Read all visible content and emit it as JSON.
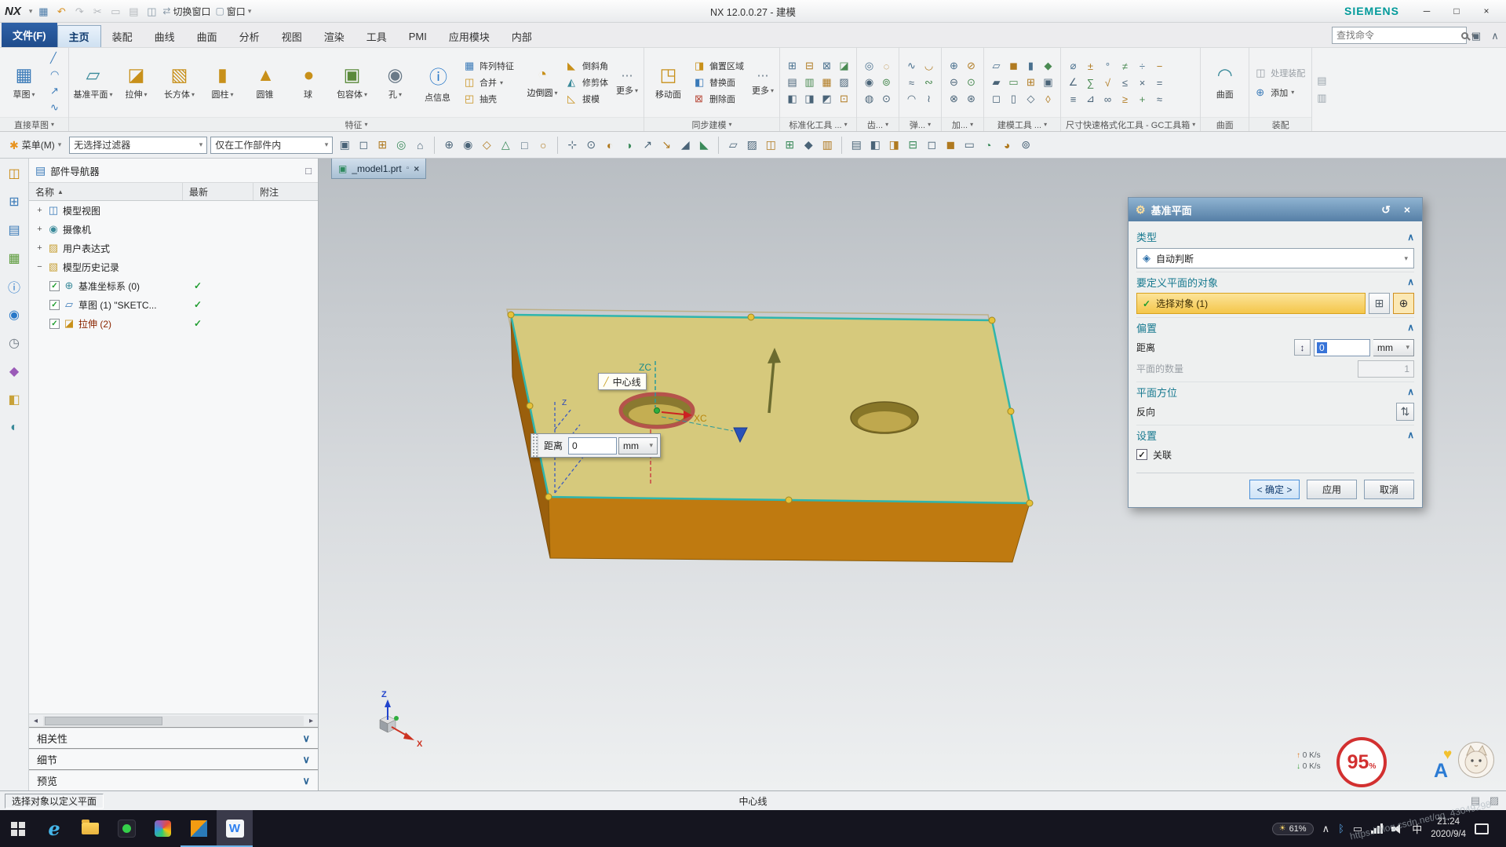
{
  "glyphs": {
    "caret": "▾",
    "chevron_up": "∧",
    "chevron_down": "∨",
    "sort_asc": "▲",
    "scroll_left": "◂",
    "scroll_right": "▸",
    "panel": "▣",
    "more": "⋯",
    "minimize": "─",
    "maximize": "□",
    "close": "×",
    "menu_star": "✱"
  },
  "titlebar": {
    "logo": "NX",
    "title": "NX 12.0.0.27 - 建模",
    "brand": "SIEMENS",
    "switch_window_label": "切换窗口",
    "window_label": "窗口",
    "qat": [
      {
        "name": "save-icon",
        "glyph": "▦",
        "color": "#4a7aa8"
      },
      {
        "name": "undo-icon",
        "glyph": "↶",
        "color": "#d89020"
      },
      {
        "name": "redo-icon",
        "glyph": "↷",
        "color": "#b4b8bc"
      },
      {
        "name": "cut-icon",
        "glyph": "✂",
        "color": "#b4b8bc"
      },
      {
        "name": "copy-icon",
        "glyph": "▭",
        "color": "#b4b8bc"
      },
      {
        "name": "paste-icon",
        "glyph": "▤",
        "color": "#b4b8bc"
      },
      {
        "name": "window-split-icon",
        "glyph": "◫",
        "color": "#8a9aa8"
      }
    ]
  },
  "tabs": {
    "file_label": "文件(F)",
    "items": [
      {
        "label": "主页",
        "active": true
      },
      {
        "label": "装配"
      },
      {
        "label": "曲线"
      },
      {
        "label": "曲面"
      },
      {
        "label": "分析"
      },
      {
        "label": "视图"
      },
      {
        "label": "渲染"
      },
      {
        "label": "工具"
      },
      {
        "label": "PMI"
      },
      {
        "label": "应用模块"
      },
      {
        "label": "内部"
      }
    ],
    "search_placeholder": "查找命令"
  },
  "ribbon": {
    "sketch": {
      "label": "直接草图",
      "main_label": "草图",
      "main_glyph": "▦",
      "small": [
        "╱",
        "◠",
        "↗",
        "∿"
      ]
    },
    "feature": {
      "label": "特征",
      "big": [
        {
          "label": "基准平面",
          "glyph": "▱",
          "color": "#3a8a9a",
          "dd": "▾"
        },
        {
          "label": "拉伸",
          "glyph": "◪",
          "color": "#c8901a",
          "dd": "▾"
        },
        {
          "label": "长方体",
          "glyph": "▧",
          "color": "#c8901a",
          "dd": "▾"
        },
        {
          "label": "圆柱",
          "glyph": "▮",
          "color": "#c8901a",
          "dd": "▾"
        },
        {
          "label": "圆锥",
          "glyph": "▲",
          "color": "#c8901a"
        },
        {
          "label": "球",
          "glyph": "●",
          "color": "#c8901a"
        },
        {
          "label": "包容体",
          "glyph": "▣",
          "color": "#5a8a3a",
          "dd": "▾"
        },
        {
          "label": "孔",
          "glyph": "◉",
          "color": "#6a7a88",
          "dd": "▾"
        },
        {
          "label": "点信息",
          "glyph": "ⓘ",
          "color": "#2878c8"
        }
      ],
      "col1": [
        {
          "label": "阵列特征",
          "glyph": "▦",
          "color": "#3a7ab8"
        },
        {
          "label": "合并",
          "glyph": "◫",
          "color": "#c8901a",
          "dd": "▾"
        },
        {
          "label": "抽壳",
          "glyph": "◰",
          "color": "#c8901a"
        }
      ],
      "medium": {
        "label": "边倒圆",
        "glyph": "◔",
        "color": "#c8901a",
        "dd": "▾"
      },
      "col2": [
        {
          "label": "倒斜角",
          "glyph": "◣",
          "color": "#c8901a"
        },
        {
          "label": "修剪体",
          "glyph": "◭",
          "color": "#3a8a9a"
        },
        {
          "label": "拔模",
          "glyph": "◺",
          "color": "#c8901a"
        }
      ],
      "more_label": "更多"
    },
    "sync": {
      "label": "同步建模",
      "main_label": "移动面",
      "main_glyph": "◳",
      "small": [
        {
          "label": "偏置区域",
          "glyph": "◨",
          "color": "#c8901a"
        },
        {
          "label": "替换面",
          "glyph": "◧",
          "color": "#3a7ab8"
        },
        {
          "label": "删除面",
          "glyph": "⊠",
          "color": "#b84a3a"
        }
      ],
      "more_label": "更多"
    },
    "clusters": [
      {
        "label": "标准化工具 ...",
        "icons": [
          "⊞",
          "▤",
          "◧",
          "⊟",
          "▥",
          "◨",
          "⊠",
          "▦",
          "◩",
          "◪",
          "▨",
          "⊡"
        ]
      },
      {
        "label": "齿...",
        "icons": [
          "◎",
          "◉",
          "◍",
          "◌",
          "⊚",
          "⊙"
        ]
      },
      {
        "label": "弹...",
        "icons": [
          "∿",
          "≈",
          "◠",
          "◡",
          "∾",
          "≀"
        ]
      },
      {
        "label": "加...",
        "icons": [
          "⊕",
          "⊖",
          "⊗",
          "⊘",
          "⊙",
          "⊛"
        ]
      },
      {
        "label": "建模工具 ...",
        "icons": [
          "▱",
          "▰",
          "◻",
          "◼",
          "▭",
          "▯",
          "▮",
          "⊞",
          "◇",
          "◆",
          "▣",
          "◊"
        ]
      },
      {
        "label": "尺寸快速格式化工具 - GC工具箱",
        "icons": [
          "⌀",
          "∠",
          "≡",
          "±",
          "∑",
          "⊿",
          "°",
          "√",
          "∞",
          "≠",
          "≤",
          "≥",
          "÷",
          "×",
          "+",
          "−",
          "=",
          "≈"
        ]
      }
    ],
    "surface": {
      "label": "曲面",
      "main_label": "曲面",
      "main_glyph": "◠"
    },
    "assembly": {
      "label": "装配",
      "process_label": "处理装配",
      "add_label": "添加"
    },
    "tail_icons": [
      "▤",
      "▥"
    ]
  },
  "toolbar2": {
    "menu_label": "菜单(M)",
    "filter_value": "无选择过滤器",
    "scope_value": "仅在工作部件内",
    "seg1": [
      "▣",
      "◻",
      "⊞",
      "◎",
      "⌂"
    ],
    "seg2": [
      "⊕",
      "◉",
      "◇",
      "△",
      "□",
      "○"
    ],
    "seg3": [
      "⊹",
      "⊙",
      "◐",
      "◑",
      "↗",
      "↘",
      "◢",
      "◣"
    ],
    "seg4": [
      "▱",
      "▨",
      "◫",
      "⊞",
      "◆",
      "▥"
    ],
    "seg5": [
      "▤",
      "◧",
      "◨",
      "⊟",
      "◻",
      "◼",
      "▭",
      "◔",
      "◕",
      "⊚"
    ]
  },
  "resource_bar": [
    {
      "name": "assembly-navigator-icon",
      "glyph": "◫",
      "color": "#c8860a"
    },
    {
      "name": "constraint-navigator-icon",
      "glyph": "⊞",
      "color": "#3a7ab8"
    },
    {
      "name": "part-navigator-icon",
      "glyph": "▤",
      "color": "#3a7ab8"
    },
    {
      "name": "reuse-library-icon",
      "glyph": "▦",
      "color": "#5a9a3a"
    },
    {
      "name": "hd3d-tools-icon",
      "glyph": "ⓘ",
      "color": "#2878c8"
    },
    {
      "name": "web-browser-icon",
      "glyph": "◉",
      "color": "#2878c8"
    },
    {
      "name": "history-icon",
      "glyph": "◷",
      "color": "#707a84"
    },
    {
      "name": "process-studio-icon",
      "glyph": "◆",
      "color": "#9a5ab8"
    },
    {
      "name": "manufacturing-wizard-icon",
      "glyph": "◧",
      "color": "#c8a23a"
    },
    {
      "name": "roles-icon",
      "glyph": "◐",
      "color": "#3a8a9a"
    }
  ],
  "navigator": {
    "title": "部件导航器",
    "col_name": "名称",
    "col_latest": "最新",
    "col_note": "附注",
    "check_glyph": "✓",
    "expand_plus": "+",
    "expand_minus": "−",
    "rows": [
      {
        "label": "模型视图",
        "icon": "◫"
      },
      {
        "label": "摄像机",
        "icon": "◉"
      },
      {
        "label": "用户表达式",
        "icon": "▨"
      },
      {
        "label": "模型历史记录",
        "icon": "▧"
      },
      {
        "label": "基准坐标系 (0)",
        "icon": "⊕"
      },
      {
        "label": "草图 (1) \"SKETC...",
        "icon": "▱"
      },
      {
        "label": "拉伸 (2)",
        "icon": "◪"
      }
    ],
    "panels": [
      "相关性",
      "细节",
      "预览"
    ]
  },
  "viewport": {
    "tab_label": "_model1.prt",
    "tooltip_label": "中心线",
    "distance_label": "距离",
    "distance_value": "0",
    "distance_unit": "mm",
    "zc_label": "ZC",
    "xc_label": "XC",
    "z_label": "Z",
    "x_label": "X",
    "sketch_z_label": "Z",
    "net_up": "0 K/s",
    "net_down": "0 K/s",
    "badge_value": "95",
    "badge_unit": "%",
    "overlay_letter": "A"
  },
  "dialog": {
    "title": "基准平面",
    "icons": {
      "gear": "⚙",
      "reset": "↺",
      "close": "×",
      "chevron": "∧",
      "caret": "▾",
      "inferred": "◈",
      "check": "✓",
      "plus": "⊞",
      "crosshair": "⊕",
      "measure": "↕",
      "reverse": "⇅"
    },
    "type_header": "类型",
    "type_value": "自动判断",
    "objects_header": "要定义平面的对象",
    "select_label": "选择对象 (1)",
    "offset_header": "偏置",
    "distance_label": "距离",
    "distance_value": "0",
    "unit": "mm",
    "count_label": "平面的数量",
    "count_value": "1",
    "orientation_header": "平面方位",
    "reverse_label": "反向",
    "settings_header": "设置",
    "associative_label": "关联",
    "ok": "< 确定 >",
    "apply": "应用",
    "cancel": "取消"
  },
  "statusbar": {
    "message": "选择对象以定义平面",
    "center_label": "中心线"
  },
  "taskbar": {
    "battery": "61%",
    "ime": "中",
    "time": "21:24",
    "date": "2020/9/4"
  },
  "watermark": "https://blog.csdn.net/qq_43049298"
}
